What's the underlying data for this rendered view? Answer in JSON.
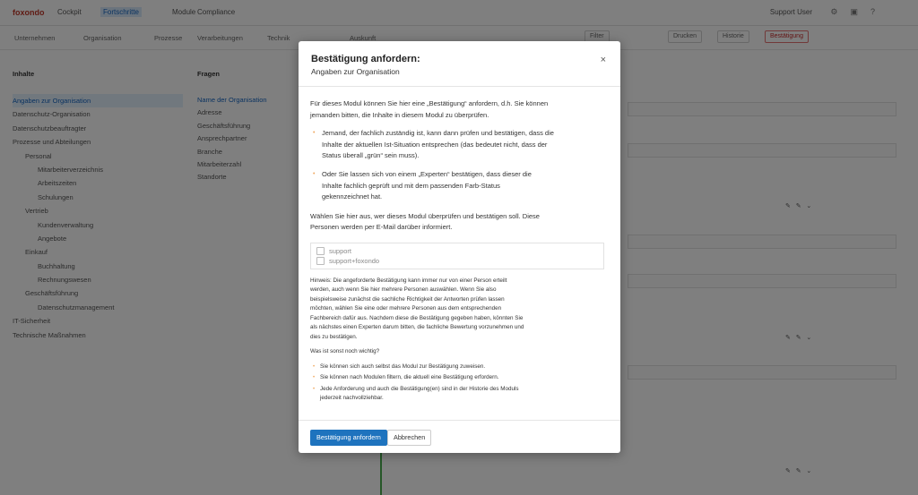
{
  "app": {
    "logo": "foxondo",
    "nav": [
      "Cockpit",
      "Fortschritte",
      "Module",
      "Compliance"
    ],
    "user": "Support User",
    "subtabs": [
      "Unternehmen",
      "Organisation",
      "Prozesse",
      "Verarbeitungen",
      "Technik",
      "Auskunft"
    ],
    "subbuttons": [
      "Filter",
      "Drucken",
      "Historie",
      "Bestätigung"
    ],
    "left_panel": {
      "heading": "Inhalte",
      "items": [
        "Angaben zur Organisation",
        "Datenschutz-Organisation",
        "Datenschutzbeauftragter",
        "Prozesse und Abteilungen",
        "Personal",
        "Mitarbeiterverzeichnis",
        "Arbeitszeiten",
        "Schulungen",
        "Vertrieb",
        "Kundenverwaltung",
        "Angebote",
        "Einkauf",
        "Buchhaltung",
        "Rechnungswesen",
        "Geschäftsführung",
        "Datenschutzmanagement",
        "IT-Sicherheit",
        "Technische Maßnahmen"
      ]
    },
    "mid_panel": {
      "heading": "Fragen",
      "items": [
        "Name der Organisation",
        "Adresse",
        "Geschäftsführung",
        "Ansprechpartner",
        "Branche",
        "Mitarbeiterzahl",
        "Standorte"
      ]
    }
  },
  "modal": {
    "title": "Bestätigung anfordern:",
    "subtitle": "Angaben zur Organisation",
    "close": "×",
    "intro": "Für dieses Modul können Sie hier eine „Bestätigung“ anfordern, d.h. Sie können jemanden bitten, die Inhalte in diesem Modul zu überprüfen.",
    "options": [
      "Jemand, der fachlich zuständig ist, kann dann prüfen und bestätigen, dass die Inhalte der aktuellen Ist-Situation entsprechen (das bedeutet nicht, dass der Status überall „grün“ sein muss).",
      "Oder Sie lassen sich von einem „Experten“ bestätigen, dass dieser die Inhalte fachlich geprüft und mit dem passenden Farb-Status gekennzeichnet hat."
    ],
    "choose_text": "Wählen Sie hier aus, wer dieses Modul überprüfen und bestätigen soll. Diese Personen werden per E-Mail darüber informiert.",
    "people": [
      "support",
      "support+foxondo"
    ],
    "hint": "Hinweis: Die angeforderte Bestätigung kann immer nur von einer Person erteilt werden, auch wenn Sie hier mehrere Personen auswählen. Wenn Sie also beispielsweise zunächst die sachliche Richtigkeit der Antworten prüfen lassen möchten, wählen Sie eine oder mehrere Personen aus dem entsprechenden Fachbereich dafür aus. Nachdem diese die Bestätigung gegeben haben, könnten Sie als nächstes einen Experten darum bitten, die fachliche Bewertung vorzunehmen und dies zu bestätigen.",
    "important_heading": "Was ist sonst noch wichtig?",
    "important": [
      "Sie können sich auch selbst das Modul zur Bestätigung zuweisen.",
      "Sie können nach Modulen filtern, die aktuell eine Bestätigung erfordern.",
      "Jede Anforderung und auch die Bestätigung(en) sind in der Historie des Moduls jederzeit nachvollziehbar."
    ],
    "primary_button": "Bestätigung anfordern",
    "secondary_button": "Abbrechen"
  },
  "colors": {
    "primary": "#1e73be",
    "bullet": "#f0a860",
    "overlay": "rgba(0,0,0,0.5)"
  }
}
